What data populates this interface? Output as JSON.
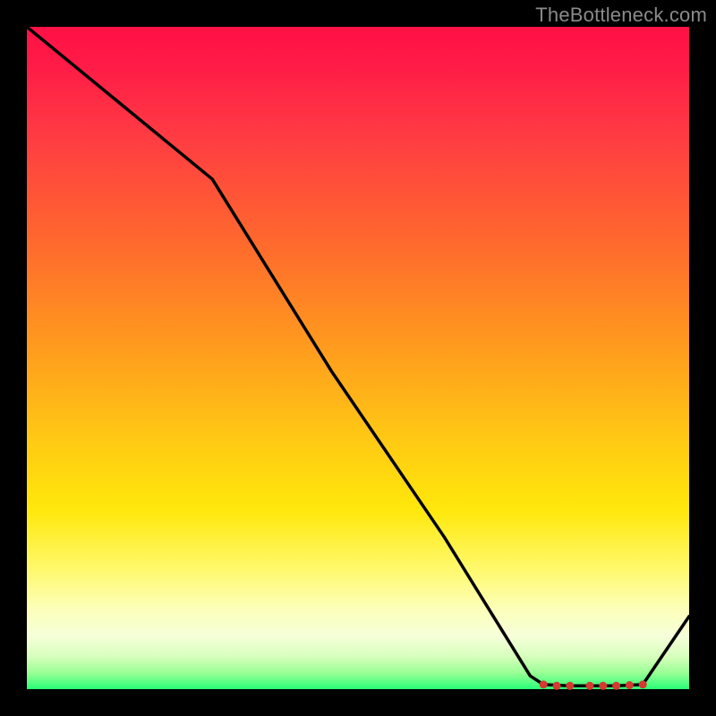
{
  "attribution": "TheBottleneck.com",
  "chart_data": {
    "type": "line",
    "title": "",
    "xlabel": "",
    "ylabel": "",
    "xlim": [
      0,
      100
    ],
    "ylim": [
      0,
      100
    ],
    "grid": false,
    "series": [
      {
        "name": "bottleneck-curve",
        "x": [
          0,
          28,
          46,
          63,
          76,
          78,
          82,
          85,
          89,
          93,
          100
        ],
        "values": [
          100,
          77,
          48,
          23,
          2,
          0.7,
          0.5,
          0.5,
          0.5,
          0.7,
          11
        ]
      }
    ],
    "markers": {
      "name": "flat-segment-dots",
      "x": [
        78,
        80,
        82,
        85,
        87,
        89,
        91,
        93
      ],
      "values": [
        0.7,
        0.5,
        0.5,
        0.5,
        0.5,
        0.5,
        0.6,
        0.7
      ],
      "color": "#d33b2f"
    }
  }
}
